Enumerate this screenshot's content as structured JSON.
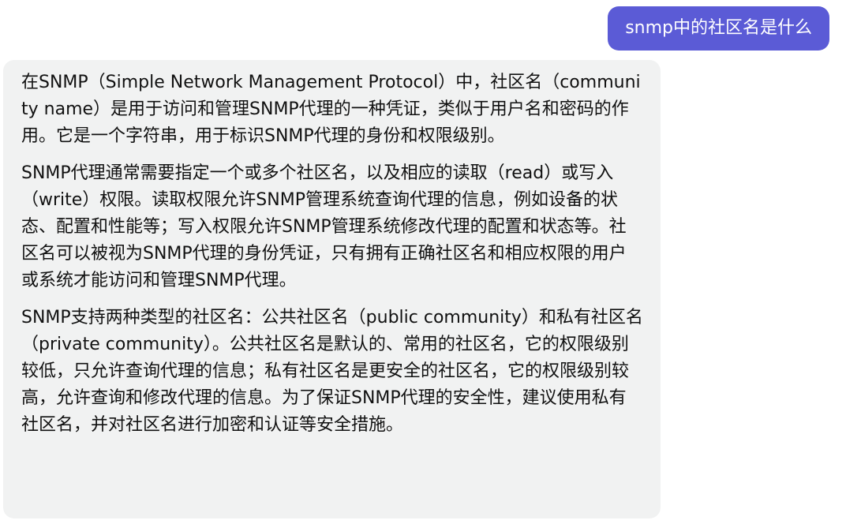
{
  "user_message": "snmp中的社区名是什么",
  "assistant_message": {
    "paragraphs": [
      "在SNMP（Simple Network Management Protocol）中，社区名（community name）是用于访问和管理SNMP代理的一种凭证，类似于用户名和密码的作用。它是一个字符串，用于标识SNMP代理的身份和权限级别。",
      "SNMP代理通常需要指定一个或多个社区名，以及相应的读取（read）或写入（write）权限。读取权限允许SNMP管理系统查询代理的信息，例如设备的状态、配置和性能等；写入权限允许SNMP管理系统修改代理的配置和状态等。社区名可以被视为SNMP代理的身份凭证，只有拥有正确社区名和相应权限的用户或系统才能访问和管理SNMP代理。",
      "SNMP支持两种类型的社区名：公共社区名（public community）和私有社区名（private community）。公共社区名是默认的、常用的社区名，它的权限级别较低，只允许查询代理的信息；私有社区名是更安全的社区名，它的权限级别较高，允许查询和修改代理的信息。为了保证SNMP代理的安全性，建议使用私有社区名，并对社区名进行加密和认证等安全措施。"
    ]
  },
  "colors": {
    "user_bubble": "#5b5bd6",
    "assistant_bubble": "#f1f2f2",
    "text": "#111111"
  }
}
